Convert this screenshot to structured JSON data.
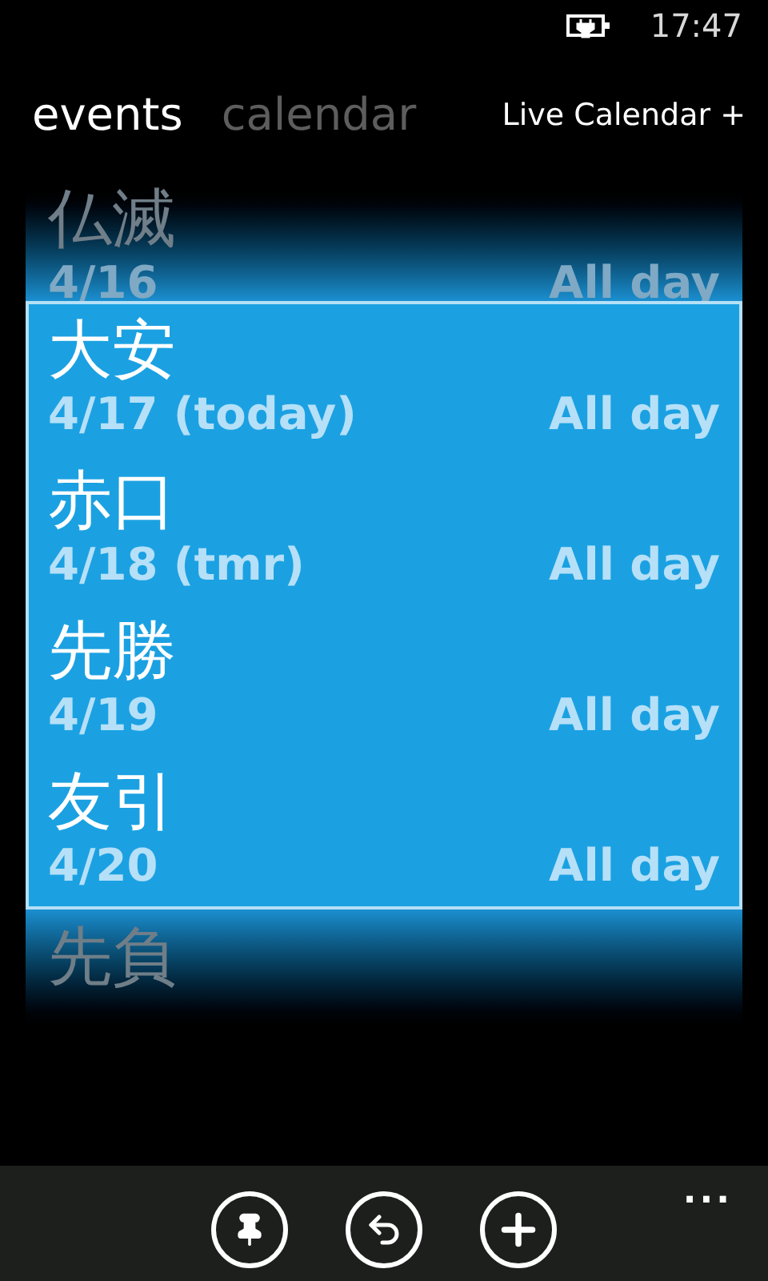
{
  "status_bar": {
    "time": "17:47"
  },
  "pivot": {
    "tabs": [
      {
        "label": "events",
        "selected": true
      },
      {
        "label": "calendar",
        "selected": false
      }
    ],
    "account": "Live Calendar +"
  },
  "events": [
    {
      "title": "仏滅",
      "date": "4/16",
      "time": "All day",
      "selected": false
    },
    {
      "title": "大安",
      "date": "4/17 (today)",
      "time": "All day",
      "selected": true
    },
    {
      "title": "赤口",
      "date": "4/18 (tmr)",
      "time": "All day",
      "selected": true
    },
    {
      "title": "先勝",
      "date": "4/19",
      "time": "All day",
      "selected": true
    },
    {
      "title": "友引",
      "date": "4/20",
      "time": "All day",
      "selected": true
    },
    {
      "title": "先負",
      "selected": false
    }
  ],
  "app_bar": {
    "buttons": [
      {
        "kind": "pin"
      },
      {
        "kind": "undo"
      },
      {
        "kind": "add"
      }
    ],
    "more": "..."
  }
}
